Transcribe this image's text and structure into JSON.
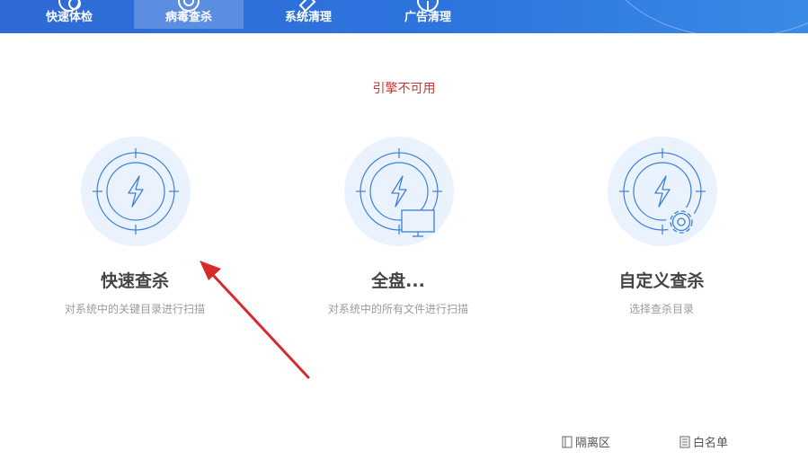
{
  "tabs": [
    {
      "label": "快速体检",
      "icon": "health-check-icon",
      "active": false
    },
    {
      "label": "病毒查杀",
      "icon": "virus-scan-icon",
      "active": true
    },
    {
      "label": "系统清理",
      "icon": "broom-icon",
      "active": false
    },
    {
      "label": "广告清理",
      "icon": "ad-clean-icon",
      "active": false
    }
  ],
  "status": {
    "text": "引擎不可用",
    "color": "#d03232"
  },
  "scan_options": [
    {
      "title": "快速查杀",
      "description": "对系统中的关键目录进行扫描",
      "icon": "lightning-target-icon"
    },
    {
      "title": "全盘...",
      "description": "对系统中的所有文件进行扫描",
      "icon": "monitor-icon"
    },
    {
      "title": "自定义查杀",
      "description": "选择查杀目录",
      "icon": "gear-icon"
    }
  ],
  "footer": {
    "quarantine_label": "隔离区",
    "whitelist_label": "白名单"
  },
  "colors": {
    "header_blue": "#2f6ad6",
    "accent_blue": "#3d7fd8",
    "circle_bg": "#eaf3fd",
    "annotation_red": "#d52b2b"
  }
}
